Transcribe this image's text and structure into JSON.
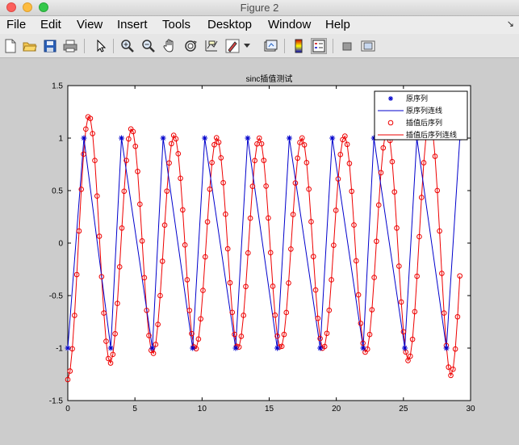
{
  "window": {
    "title": "Figure 2"
  },
  "menu": {
    "items": [
      "File",
      "Edit",
      "View",
      "Insert",
      "Tools",
      "Desktop",
      "Window",
      "Help"
    ],
    "arrow": "↘"
  },
  "toolbar": {
    "icons": [
      "new-figure-icon",
      "open-file-icon",
      "save-icon",
      "print-icon",
      "pointer-icon",
      "zoom-in-icon",
      "zoom-out-icon",
      "pan-hand-icon",
      "rotate-3d-icon",
      "data-cursor-icon",
      "brush-icon",
      "brush-dropdown-icon",
      "link-plot-icon",
      "colorbar-icon",
      "legend-icon",
      "hide-plot-tools-icon",
      "show-plot-tools-icon"
    ]
  },
  "colors": {
    "original_series": "#0000cc",
    "interp_series": "#ee0000",
    "plot_bg": "#ffffff",
    "figure_bg": "#cccccc"
  },
  "chart_data": {
    "type": "line",
    "title": "sinc插值测试",
    "xlabel": "",
    "ylabel": "",
    "xlim": [
      0,
      30
    ],
    "ylim": [
      -1.5,
      1.5
    ],
    "xticks": [
      0,
      5,
      10,
      15,
      20,
      25,
      30
    ],
    "yticks": [
      -1.5,
      -1,
      -0.5,
      0,
      0.5,
      1,
      1.5
    ],
    "xtick_labels": [
      "0",
      "5",
      "10",
      "15",
      "20",
      "25",
      "30"
    ],
    "ytick_labels": [
      "-1.5",
      "-1",
      "-0.5",
      "0",
      "0.5",
      "1",
      "1.5"
    ],
    "grid": false,
    "legend_position": "top-right",
    "legend": [
      "原序列",
      "原序列连线",
      "插值后序列",
      "插值后序列连线"
    ],
    "series": [
      {
        "name": "原序列",
        "marker": "*",
        "x": [
          0,
          1.2,
          3.2,
          4,
          6.3,
          7.1,
          9.3,
          10.2,
          12.5,
          13.4,
          15.6,
          16.5,
          18.8,
          19.7,
          22.0,
          22.8,
          25.1,
          26.0,
          28.2,
          29.2
        ],
        "y": [
          -1,
          1,
          -1,
          1,
          -1,
          1,
          -1,
          1,
          -1,
          1,
          -1,
          1,
          -1,
          1,
          -1,
          1,
          -1,
          1,
          -1,
          1
        ]
      },
      {
        "name": "原序列连线",
        "marker": "",
        "x": [
          0,
          1.2,
          3.2,
          4,
          6.3,
          7.1,
          9.3,
          10.2,
          12.5,
          13.4,
          15.6,
          16.5,
          18.8,
          19.7,
          22.0,
          22.8,
          25.1,
          26.0,
          28.2,
          29.2
        ],
        "y": [
          -1,
          1,
          -1,
          1,
          -1,
          1,
          -1,
          1,
          -1,
          1,
          -1,
          1,
          -1,
          1,
          -1,
          1,
          -1,
          1,
          -1,
          1
        ]
      },
      {
        "name": "插值后序列",
        "marker": "o",
        "period": 3.17,
        "phase": -0.79,
        "x_start": 0,
        "x_end": 29.2,
        "points": 175,
        "amp_max": 1.3,
        "amp_min": 1.0
      },
      {
        "name": "插值后序列连线",
        "marker": ""
      }
    ]
  }
}
